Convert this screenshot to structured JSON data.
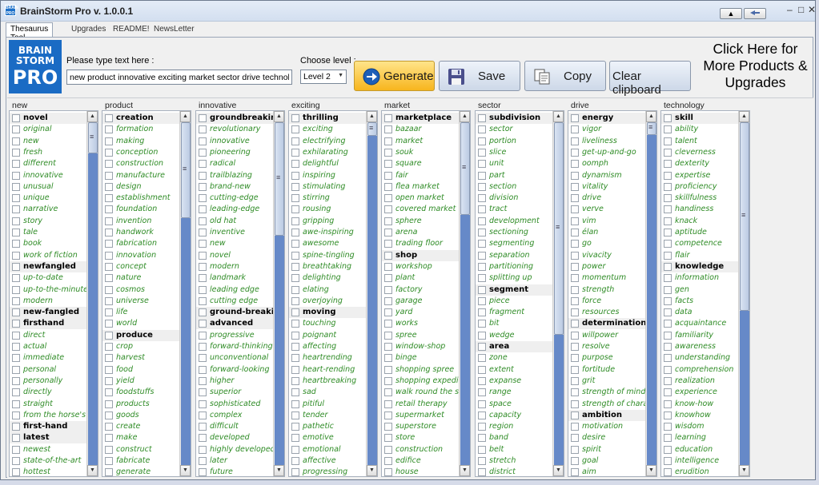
{
  "window": {
    "title": "BrainStorm Pro v. 1.0.0.1",
    "minimize": "–",
    "maximize": "□",
    "close": "✕",
    "collapse_label": "▲"
  },
  "tabs": [
    "Thesaurus Tool",
    "Upgrades",
    "README!",
    "NewsLetter"
  ],
  "logo": {
    "line1": "BRAIN",
    "line2": "STORM",
    "line3": "PRO"
  },
  "input": {
    "label": "Please type text here :",
    "value": "new product innovative exciting market sector drive technology"
  },
  "level": {
    "label": "Choose level :",
    "value": "Level 2"
  },
  "buttons": {
    "generate": "Generate",
    "save": "Save",
    "copy": "Copy",
    "clear": "Clear clipboard"
  },
  "promo": {
    "line1": "Click Here for",
    "line2": "More Products &",
    "line3": "Upgrades"
  },
  "colors": {
    "synonym": "#2e8b25",
    "scroll_track": "#6689c8",
    "generate_bg": "#f7b51d",
    "logo_bg": "#1a6bc4"
  },
  "columns": [
    {
      "header": "new",
      "scroll": {
        "thumb_top": 0.0,
        "thumb_size": 0.09
      },
      "items": [
        {
          "t": "novel",
          "h": true
        },
        {
          "t": "original"
        },
        {
          "t": "new"
        },
        {
          "t": "fresh"
        },
        {
          "t": "different"
        },
        {
          "t": "innovative"
        },
        {
          "t": "unusual"
        },
        {
          "t": "unique"
        },
        {
          "t": "narrative"
        },
        {
          "t": "story"
        },
        {
          "t": "tale"
        },
        {
          "t": "book"
        },
        {
          "t": "work of fiction"
        },
        {
          "t": "newfangled",
          "h": true
        },
        {
          "t": "up-to-date"
        },
        {
          "t": "up-to-the-minute"
        },
        {
          "t": "modern"
        },
        {
          "t": "new-fangled",
          "h": true
        },
        {
          "t": "firsthand",
          "h": true
        },
        {
          "t": "direct"
        },
        {
          "t": "actual"
        },
        {
          "t": "immediate"
        },
        {
          "t": "personal"
        },
        {
          "t": "personally"
        },
        {
          "t": "directly"
        },
        {
          "t": "straight"
        },
        {
          "t": "from the horse's mouth"
        },
        {
          "t": "first-hand",
          "h": true
        },
        {
          "t": "latest",
          "h": true
        },
        {
          "t": "newest"
        },
        {
          "t": "state-of-the-art"
        },
        {
          "t": "hottest"
        }
      ]
    },
    {
      "header": "product",
      "scroll": {
        "thumb_top": 0.0,
        "thumb_size": 0.28
      },
      "items": [
        {
          "t": "creation",
          "h": true
        },
        {
          "t": "formation"
        },
        {
          "t": "making"
        },
        {
          "t": "conception"
        },
        {
          "t": "construction"
        },
        {
          "t": "manufacture"
        },
        {
          "t": "design"
        },
        {
          "t": "establishment"
        },
        {
          "t": "foundation"
        },
        {
          "t": "invention"
        },
        {
          "t": "handwork"
        },
        {
          "t": "fabrication"
        },
        {
          "t": "innovation"
        },
        {
          "t": "concept"
        },
        {
          "t": "nature"
        },
        {
          "t": "cosmos"
        },
        {
          "t": "universe"
        },
        {
          "t": "life"
        },
        {
          "t": "world"
        },
        {
          "t": "produce",
          "h": true
        },
        {
          "t": "crop"
        },
        {
          "t": "harvest"
        },
        {
          "t": "food"
        },
        {
          "t": "yield"
        },
        {
          "t": "foodstuffs"
        },
        {
          "t": "products"
        },
        {
          "t": "goods"
        },
        {
          "t": "create"
        },
        {
          "t": "make"
        },
        {
          "t": "construct"
        },
        {
          "t": "fabricate"
        },
        {
          "t": "generate"
        }
      ]
    },
    {
      "header": "innovative",
      "scroll": {
        "thumb_top": 0.0,
        "thumb_size": 0.33
      },
      "items": [
        {
          "t": "groundbreaking",
          "h": true
        },
        {
          "t": "revolutionary"
        },
        {
          "t": "innovative"
        },
        {
          "t": "pioneering"
        },
        {
          "t": "radical"
        },
        {
          "t": "trailblazing"
        },
        {
          "t": "brand-new"
        },
        {
          "t": "cutting-edge"
        },
        {
          "t": "leading-edge"
        },
        {
          "t": "old hat"
        },
        {
          "t": "inventive"
        },
        {
          "t": "new"
        },
        {
          "t": "novel"
        },
        {
          "t": "modern"
        },
        {
          "t": "landmark"
        },
        {
          "t": "leading edge"
        },
        {
          "t": "cutting edge"
        },
        {
          "t": "ground-breaking",
          "h": true
        },
        {
          "t": "advanced",
          "h": true
        },
        {
          "t": "progressive"
        },
        {
          "t": "forward-thinking"
        },
        {
          "t": "unconventional"
        },
        {
          "t": "forward-looking"
        },
        {
          "t": "higher"
        },
        {
          "t": "superior"
        },
        {
          "t": "sophisticated"
        },
        {
          "t": "complex"
        },
        {
          "t": "difficult"
        },
        {
          "t": "developed"
        },
        {
          "t": "highly developed"
        },
        {
          "t": "later"
        },
        {
          "t": "future"
        }
      ]
    },
    {
      "header": "exciting",
      "scroll": {
        "thumb_top": 0.0,
        "thumb_size": 0.04
      },
      "items": [
        {
          "t": "thrilling",
          "h": true
        },
        {
          "t": "exciting"
        },
        {
          "t": "electrifying"
        },
        {
          "t": "exhilarating"
        },
        {
          "t": "delightful"
        },
        {
          "t": "inspiring"
        },
        {
          "t": "stimulating"
        },
        {
          "t": "stirring"
        },
        {
          "t": "rousing"
        },
        {
          "t": "gripping"
        },
        {
          "t": "awe-inspiring"
        },
        {
          "t": "awesome"
        },
        {
          "t": "spine-tingling"
        },
        {
          "t": "breathtaking"
        },
        {
          "t": "delighting"
        },
        {
          "t": "elating"
        },
        {
          "t": "overjoying"
        },
        {
          "t": "moving",
          "h": true
        },
        {
          "t": "touching"
        },
        {
          "t": "poignant"
        },
        {
          "t": "affecting"
        },
        {
          "t": "heartrending"
        },
        {
          "t": "heart-rending"
        },
        {
          "t": "heartbreaking"
        },
        {
          "t": "sad"
        },
        {
          "t": "pitiful"
        },
        {
          "t": "tender"
        },
        {
          "t": "pathetic"
        },
        {
          "t": "emotive"
        },
        {
          "t": "emotional"
        },
        {
          "t": "affective"
        },
        {
          "t": "progressing"
        }
      ]
    },
    {
      "header": "market",
      "scroll": {
        "thumb_top": 0.0,
        "thumb_size": 0.27
      },
      "items": [
        {
          "t": "marketplace",
          "h": true
        },
        {
          "t": "bazaar"
        },
        {
          "t": "market"
        },
        {
          "t": "souk"
        },
        {
          "t": "square"
        },
        {
          "t": "fair"
        },
        {
          "t": "flea market"
        },
        {
          "t": "open market"
        },
        {
          "t": "covered market"
        },
        {
          "t": "sphere"
        },
        {
          "t": "arena"
        },
        {
          "t": "trading floor"
        },
        {
          "t": "shop",
          "h": true
        },
        {
          "t": "workshop"
        },
        {
          "t": "plant"
        },
        {
          "t": "factory"
        },
        {
          "t": "garage"
        },
        {
          "t": "yard"
        },
        {
          "t": "works"
        },
        {
          "t": "spree"
        },
        {
          "t": "window-shop"
        },
        {
          "t": "binge"
        },
        {
          "t": "shopping spree"
        },
        {
          "t": "shopping expedition"
        },
        {
          "t": "walk round the shops"
        },
        {
          "t": "retail therapy"
        },
        {
          "t": "supermarket"
        },
        {
          "t": "superstore"
        },
        {
          "t": "store"
        },
        {
          "t": "construction"
        },
        {
          "t": "edifice"
        },
        {
          "t": "house"
        }
      ]
    },
    {
      "header": "sector",
      "scroll": {
        "thumb_top": 0.0,
        "thumb_size": 0.62
      },
      "items": [
        {
          "t": "subdivision",
          "h": true
        },
        {
          "t": "sector"
        },
        {
          "t": "portion"
        },
        {
          "t": "slice"
        },
        {
          "t": "unit"
        },
        {
          "t": "part"
        },
        {
          "t": "section"
        },
        {
          "t": "division"
        },
        {
          "t": "tract"
        },
        {
          "t": "development"
        },
        {
          "t": "sectioning"
        },
        {
          "t": "segmenting"
        },
        {
          "t": "separation"
        },
        {
          "t": "partitioning"
        },
        {
          "t": "splitting up"
        },
        {
          "t": "segment",
          "h": true
        },
        {
          "t": "piece"
        },
        {
          "t": "fragment"
        },
        {
          "t": "bit"
        },
        {
          "t": "wedge"
        },
        {
          "t": "area",
          "h": true
        },
        {
          "t": "zone"
        },
        {
          "t": "extent"
        },
        {
          "t": "expanse"
        },
        {
          "t": "range"
        },
        {
          "t": "space"
        },
        {
          "t": "capacity"
        },
        {
          "t": "region"
        },
        {
          "t": "band"
        },
        {
          "t": "belt"
        },
        {
          "t": "stretch"
        },
        {
          "t": "district"
        }
      ]
    },
    {
      "header": "drive",
      "scroll": {
        "thumb_top": 0.0,
        "thumb_size": 0.02
      },
      "items": [
        {
          "t": "energy",
          "h": true
        },
        {
          "t": "vigor"
        },
        {
          "t": "liveliness"
        },
        {
          "t": "get-up-and-go"
        },
        {
          "t": "oomph"
        },
        {
          "t": "dynamism"
        },
        {
          "t": "vitality"
        },
        {
          "t": "drive"
        },
        {
          "t": "verve"
        },
        {
          "t": "vim"
        },
        {
          "t": "élan"
        },
        {
          "t": "go"
        },
        {
          "t": "vivacity"
        },
        {
          "t": "power"
        },
        {
          "t": "momentum"
        },
        {
          "t": "strength"
        },
        {
          "t": "force"
        },
        {
          "t": "resources"
        },
        {
          "t": "determination",
          "h": true
        },
        {
          "t": "willpower"
        },
        {
          "t": "resolve"
        },
        {
          "t": "purpose"
        },
        {
          "t": "fortitude"
        },
        {
          "t": "grit"
        },
        {
          "t": "strength of mind"
        },
        {
          "t": "strength of character"
        },
        {
          "t": "ambition",
          "h": true
        },
        {
          "t": "motivation"
        },
        {
          "t": "desire"
        },
        {
          "t": "spirit"
        },
        {
          "t": "goal"
        },
        {
          "t": "aim"
        }
      ]
    },
    {
      "header": "technology",
      "scroll": {
        "thumb_top": 0.0,
        "thumb_size": 0.55
      },
      "items": [
        {
          "t": "skill",
          "h": true
        },
        {
          "t": "ability"
        },
        {
          "t": "talent"
        },
        {
          "t": "cleverness"
        },
        {
          "t": "dexterity"
        },
        {
          "t": "expertise"
        },
        {
          "t": "proficiency"
        },
        {
          "t": "skillfulness"
        },
        {
          "t": "handiness"
        },
        {
          "t": "knack"
        },
        {
          "t": "aptitude"
        },
        {
          "t": "competence"
        },
        {
          "t": "flair"
        },
        {
          "t": "knowledge",
          "h": true
        },
        {
          "t": "information"
        },
        {
          "t": "gen"
        },
        {
          "t": "facts"
        },
        {
          "t": "data"
        },
        {
          "t": "acquaintance"
        },
        {
          "t": "familiarity"
        },
        {
          "t": "awareness"
        },
        {
          "t": "understanding"
        },
        {
          "t": "comprehension"
        },
        {
          "t": "realization"
        },
        {
          "t": "experience"
        },
        {
          "t": "know-how"
        },
        {
          "t": "knowhow"
        },
        {
          "t": "wisdom"
        },
        {
          "t": "learning"
        },
        {
          "t": "education"
        },
        {
          "t": "intelligence"
        },
        {
          "t": "erudition"
        }
      ]
    }
  ]
}
